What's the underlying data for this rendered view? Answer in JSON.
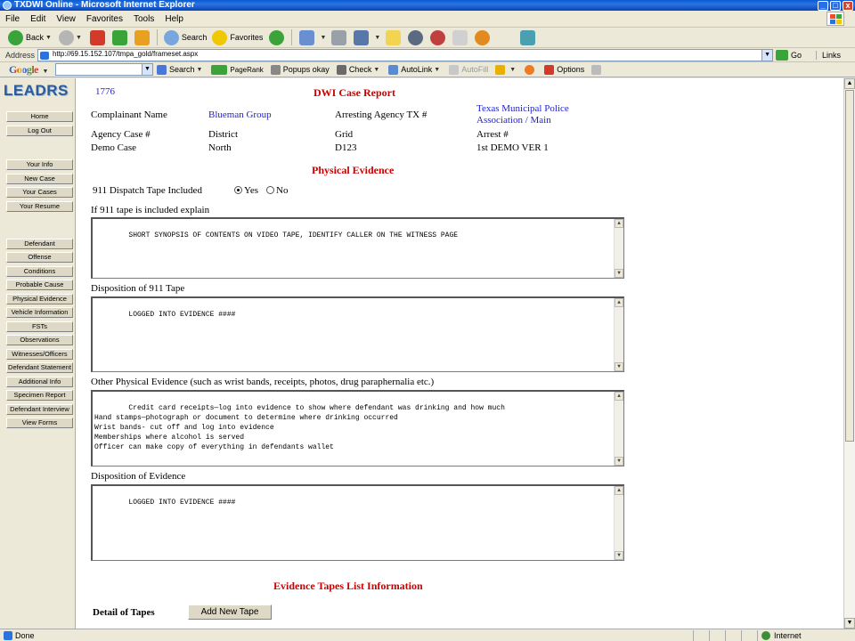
{
  "window": {
    "title": "TXDWI Online - Microsoft Internet Explorer",
    "controls": [
      "_",
      "□",
      "x"
    ]
  },
  "menu": [
    "File",
    "Edit",
    "View",
    "Favorites",
    "Tools",
    "Help"
  ],
  "toolbar": {
    "back_label": "Back",
    "search_label": "Search",
    "favorites_label": "Favorites"
  },
  "address": {
    "label": "Address",
    "url": "http://69.15.152.107/tmpa_gold/frameset.aspx",
    "go_label": "Go",
    "links_label": "Links"
  },
  "googlebar": {
    "logo": "Google",
    "search_label": "Search",
    "pagerank_label": "PageRank",
    "popups_label": "Popups okay",
    "check_label": "Check",
    "autolink_label": "AutoLink",
    "autofill_label": "AutoFill",
    "options_label": "Options"
  },
  "sidebar": {
    "logo": "LEADRS",
    "group1": [
      "Home",
      "Log Out"
    ],
    "group2": [
      "Your Info",
      "New Case",
      "Your Cases",
      "Your Resume"
    ],
    "group3": [
      "Defendant",
      "Offense",
      "Conditions",
      "Probable Cause",
      "Physical Evidence",
      "Vehicle Information",
      "FSTs",
      "Observations",
      "Witnesses/Officers",
      "Defendant Statement",
      "Additional Info",
      "Specimen Report",
      "Defendant Interview",
      "View Forms"
    ]
  },
  "report": {
    "case_id": "1776",
    "title": "DWI Case Report",
    "complainant_label": "Complainant Name",
    "complainant_value": "Blueman Group",
    "arresting_label": "Arresting Agency TX #",
    "arresting_value_line1": "Texas Municipal Police",
    "arresting_value_line2": "Association / Main",
    "row2": [
      "Agency Case #",
      "District",
      "Grid",
      "Arrest #"
    ],
    "row3": [
      "Demo Case",
      "North",
      "D123",
      "1st DEMO VER 1"
    ]
  },
  "physical_evidence": {
    "heading": "Physical Evidence",
    "dispatch_label": "911 Dispatch Tape Included",
    "radio_yes": "Yes",
    "radio_no": "No",
    "radio_selected": "Yes",
    "explain_label": "If 911 tape is included explain",
    "explain_value": "SHORT SYNOPSIS OF CONTENTS ON VIDEO TAPE, IDENTIFY CALLER ON THE WITNESS PAGE",
    "disposition_911_label": "Disposition of 911 Tape",
    "disposition_911_value": "LOGGED INTO EVIDENCE ####",
    "other_label": "Other Physical Evidence (such as wrist bands, receipts, photos, drug paraphernalia etc.)",
    "other_value": "Credit card receipts—log into evidence to show where defendant was drinking and how much\nHand stamps—photograph or document to determine where drinking occurred\nWrist bands- cut off and log into evidence\nMemberships where alcohol is served\nOfficer can make copy of everything in defendants wallet",
    "disposition_evidence_label": "Disposition of Evidence",
    "disposition_evidence_value": "LOGGED INTO EVIDENCE ####"
  },
  "tapes": {
    "heading": "Evidence Tapes List Information",
    "detail_label": "Detail of Tapes",
    "add_button": "Add New Tape"
  },
  "status": {
    "text": "Done",
    "zone": "Internet"
  },
  "colors": {
    "titlebar": "#0a5bd4",
    "heading_red": "#cc0000",
    "link_blue": "#2222cc",
    "logo_blue": "#2c5b9a"
  }
}
